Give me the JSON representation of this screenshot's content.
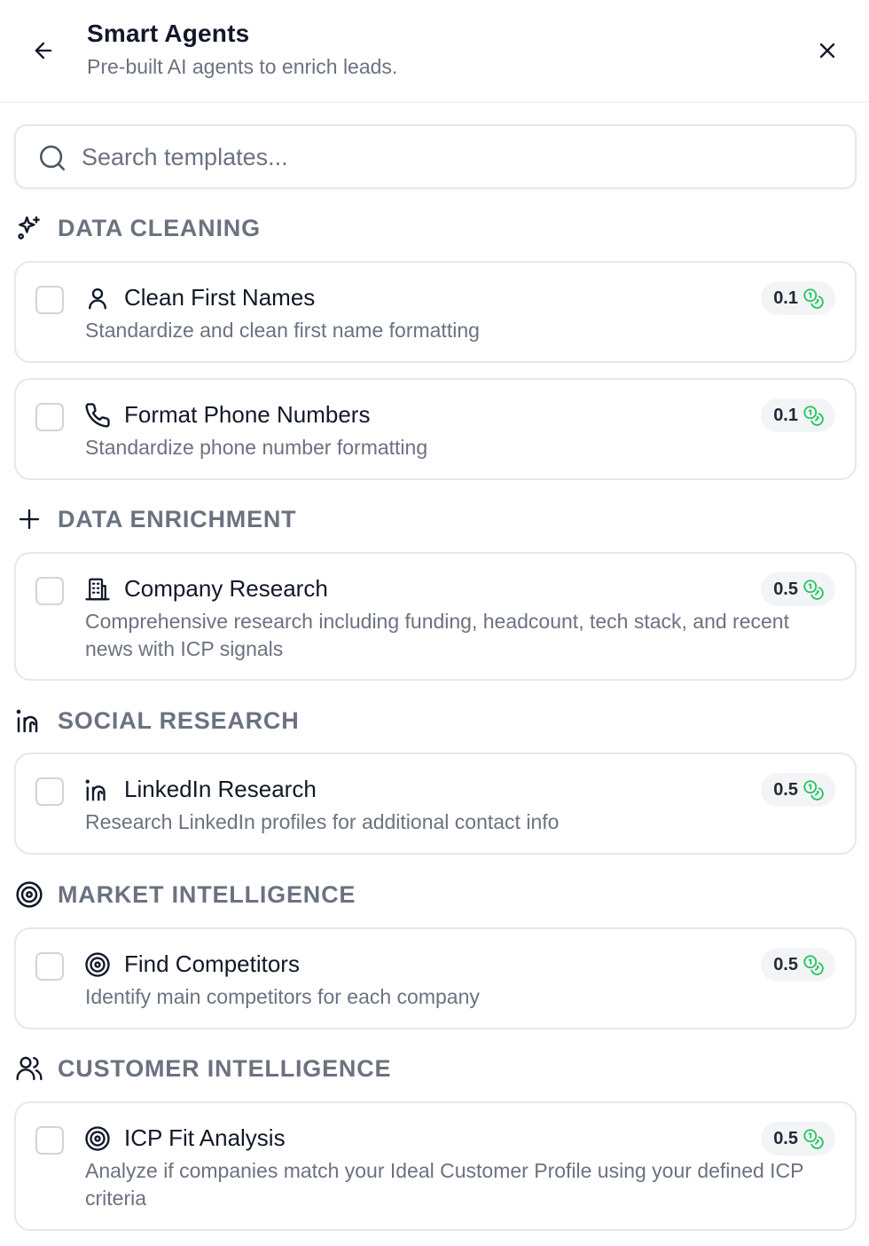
{
  "header": {
    "title": "Smart Agents",
    "subtitle": "Pre-built AI agents to enrich leads."
  },
  "search": {
    "placeholder": "Search templates..."
  },
  "sections": [
    {
      "title": "DATA CLEANING",
      "icon": "sparkles-icon",
      "cards": [
        {
          "title": "Clean First Names",
          "description": "Standardize and clean first name formatting",
          "cost": "0.1",
          "icon": "user-icon"
        },
        {
          "title": "Format Phone Numbers",
          "description": "Standardize phone number formatting",
          "cost": "0.1",
          "icon": "phone-icon"
        }
      ]
    },
    {
      "title": "DATA ENRICHMENT",
      "icon": "plus-icon",
      "cards": [
        {
          "title": "Company Research",
          "description": "Comprehensive research including funding, headcount, tech stack, and recent news with ICP signals",
          "cost": "0.5",
          "icon": "building-icon"
        }
      ]
    },
    {
      "title": "SOCIAL RESEARCH",
      "icon": "linkedin-icon",
      "cards": [
        {
          "title": "LinkedIn Research",
          "description": "Research LinkedIn profiles for additional contact info",
          "cost": "0.5",
          "icon": "linkedin-icon"
        }
      ]
    },
    {
      "title": "MARKET INTELLIGENCE",
      "icon": "target-icon",
      "cards": [
        {
          "title": "Find Competitors",
          "description": "Identify main competitors for each company",
          "cost": "0.5",
          "icon": "target-icon"
        }
      ]
    },
    {
      "title": "CUSTOMER INTELLIGENCE",
      "icon": "users-icon",
      "cards": [
        {
          "title": "ICP Fit Analysis",
          "description": "Analyze if companies match your Ideal Customer Profile using your defined ICP criteria",
          "cost": "0.5",
          "icon": "target-icon"
        }
      ]
    }
  ],
  "colors": {
    "coin": "#22c55e",
    "muted_text": "#6b7280",
    "border": "#e5e7eb"
  }
}
